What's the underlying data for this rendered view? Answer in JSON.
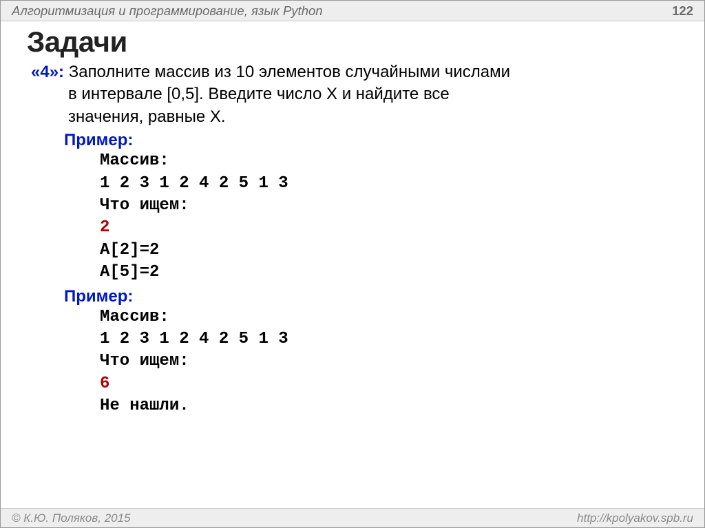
{
  "header": {
    "course": "Алгоритмизация и программирование, язык Python",
    "page_number": "122"
  },
  "title": "Задачи",
  "task": {
    "grade": "«4»:",
    "text_line1": "Заполните массив из 10 элементов случайными числами",
    "text_line2": "в интервале [0,5]. Введите число X и найдите все",
    "text_line3": "значения, равные X."
  },
  "example1": {
    "label": "Пример:",
    "arr_label": "Массив:",
    "arr_values": "1 2 3 1 2 4 2 5 1 3",
    "prompt": "Что ищем:",
    "input": "2",
    "out1": "A[2]=2",
    "out2": "A[5]=2"
  },
  "example2": {
    "label": "Пример:",
    "arr_label": "Массив:",
    "arr_values": "1 2 3 1 2 4 2 5 1 3",
    "prompt": "Что ищем:",
    "input": "6",
    "out": "Не нашли."
  },
  "footer": {
    "copyright": "© К.Ю. Поляков, 2015",
    "url": "http://kpolyakov.spb.ru"
  }
}
